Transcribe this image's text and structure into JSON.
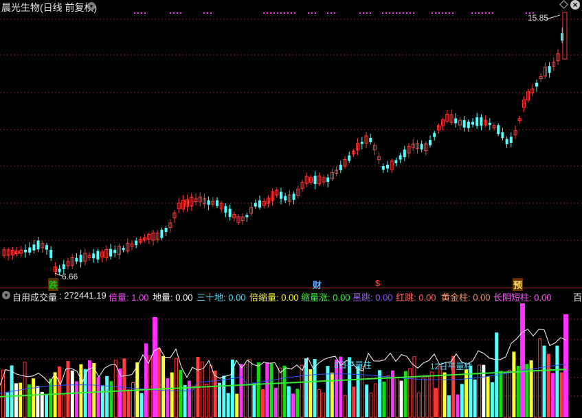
{
  "header": {
    "title": "晨光生物(日线 前复权)"
  },
  "price_panel": {
    "high_label": "15.85",
    "low_label": "6.66",
    "tags": [
      {
        "text": "跌",
        "color": "#1fbf1f",
        "bg": "#553300"
      },
      {
        "text": "财",
        "color": "#66aaff",
        "bg": ""
      },
      {
        "text": "$",
        "color": "#ff3030",
        "bg": ""
      },
      {
        "text": "预",
        "color": "#ffdd66",
        "bg": "#663300"
      }
    ]
  },
  "indicator": {
    "name": "自用成交量",
    "value": ": 272441.19",
    "items": [
      {
        "label": "倍量",
        "value": "1.00",
        "color": "#ff44ff"
      },
      {
        "label": "地量",
        "value": "0.00",
        "color": "#ffffff"
      },
      {
        "label": "三十地",
        "value": "0.00",
        "color": "#55ddff"
      },
      {
        "label": "倍缩量",
        "value": "0.00",
        "color": "#ffff33"
      },
      {
        "label": "缩量涨",
        "value": "0.00",
        "color": "#33ff33"
      },
      {
        "label": "黑跳",
        "value": "0.00",
        "color": "#9955ff"
      },
      {
        "label": "红跳",
        "value": "0.00",
        "color": "#ff6666"
      },
      {
        "label": "黄金柱",
        "value": "0.00",
        "color": "#ff9966"
      },
      {
        "label": "长阴短柱",
        "value": "0.00",
        "color": "#ff55ff"
      }
    ],
    "right_label": "百",
    "annotations": [
      "8日平量柱",
      "12日平量柱"
    ]
  },
  "colors": {
    "up": "#ff3b3b",
    "down": "#54ffff",
    "grid": "#7a1f1f",
    "ma_white": "#ffffff",
    "ma_blue": "#3355ff",
    "ma_green": "#33ee33",
    "magenta": "#ff33ff"
  }
}
